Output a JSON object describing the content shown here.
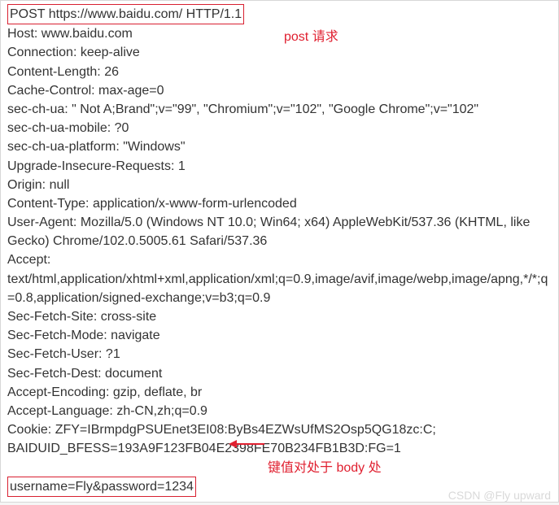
{
  "request_line": "POST https://www.baidu.com/ HTTP/1.1",
  "headers": [
    "Host: www.baidu.com",
    "Connection: keep-alive",
    "Content-Length: 26",
    "Cache-Control: max-age=0",
    "sec-ch-ua: \" Not A;Brand\";v=\"99\", \"Chromium\";v=\"102\", \"Google Chrome\";v=\"102\"",
    "sec-ch-ua-mobile: ?0",
    "sec-ch-ua-platform: \"Windows\"",
    "Upgrade-Insecure-Requests: 1",
    "Origin: null",
    "Content-Type: application/x-www-form-urlencoded",
    "User-Agent: Mozilla/5.0 (Windows NT 10.0; Win64; x64) AppleWebKit/537.36 (KHTML, like Gecko) Chrome/102.0.5005.61 Safari/537.36",
    "Accept: text/html,application/xhtml+xml,application/xml;q=0.9,image/avif,image/webp,image/apng,*/*;q=0.8,application/signed-exchange;v=b3;q=0.9",
    "Sec-Fetch-Site: cross-site",
    "Sec-Fetch-Mode: navigate",
    "Sec-Fetch-User: ?1",
    "Sec-Fetch-Dest: document",
    "Accept-Encoding: gzip, deflate, br",
    "Accept-Language: zh-CN,zh;q=0.9",
    "Cookie: ZFY=IBrmpdgPSUEnet3EI08:ByBs4EZWsUfMS2Osp5QG18zc:C; BAIDUID_BFESS=193A9F123FB04E2398FE70B234FB1B3D:FG=1"
  ],
  "body": "username=Fly&password=1234",
  "annotation_post": "post 请求",
  "annotation_body": "键值对处于 body 处",
  "watermark": "CSDN @Fly upward"
}
